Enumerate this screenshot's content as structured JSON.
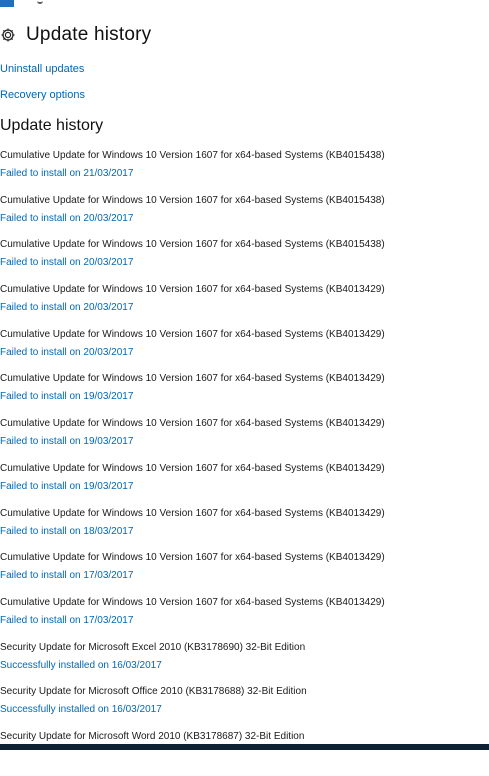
{
  "header": {
    "title": "Update history",
    "icon": "gear-icon"
  },
  "links": {
    "uninstall": "Uninstall updates",
    "recovery": "Recovery options"
  },
  "section": {
    "heading": "Update history"
  },
  "updates": [
    {
      "name": "Cumulative Update for Windows 10 Version 1607 for x64-based Systems (KB4015438)",
      "status": "Failed to install on 21/03/2017"
    },
    {
      "name": "Cumulative Update for Windows 10 Version 1607 for x64-based Systems (KB4015438)",
      "status": "Failed to install on 20/03/2017"
    },
    {
      "name": "Cumulative Update for Windows 10 Version 1607 for x64-based Systems (KB4015438)",
      "status": "Failed to install on 20/03/2017"
    },
    {
      "name": "Cumulative Update for Windows 10 Version 1607 for x64-based Systems (KB4013429)",
      "status": "Failed to install on 20/03/2017"
    },
    {
      "name": "Cumulative Update for Windows 10 Version 1607 for x64-based Systems (KB4013429)",
      "status": "Failed to install on 20/03/2017"
    },
    {
      "name": "Cumulative Update for Windows 10 Version 1607 for x64-based Systems (KB4013429)",
      "status": "Failed to install on 19/03/2017"
    },
    {
      "name": "Cumulative Update for Windows 10 Version 1607 for x64-based Systems (KB4013429)",
      "status": "Failed to install on 19/03/2017"
    },
    {
      "name": "Cumulative Update for Windows 10 Version 1607 for x64-based Systems (KB4013429)",
      "status": "Failed to install on 19/03/2017"
    },
    {
      "name": "Cumulative Update for Windows 10 Version 1607 for x64-based Systems (KB4013429)",
      "status": "Failed to install on 18/03/2017"
    },
    {
      "name": "Cumulative Update for Windows 10 Version 1607 for x64-based Systems (KB4013429)",
      "status": "Failed to install on 17/03/2017"
    },
    {
      "name": "Cumulative Update for Windows 10 Version 1607 for x64-based Systems (KB4013429)",
      "status": "Failed to install on 17/03/2017"
    },
    {
      "name": "Security Update for Microsoft Excel 2010 (KB3178690) 32-Bit Edition",
      "status": "Successfully installed on 16/03/2017"
    },
    {
      "name": "Security Update for Microsoft Office 2010 (KB3178688) 32-Bit Edition",
      "status": "Successfully installed on 16/03/2017"
    },
    {
      "name": "Security Update for Microsoft Word 2010 (KB3178687) 32-Bit Edition",
      "status": ""
    }
  ],
  "colors": {
    "link": "#0066b4",
    "accent": "#1e6fc4",
    "text": "#1a1a1a"
  }
}
